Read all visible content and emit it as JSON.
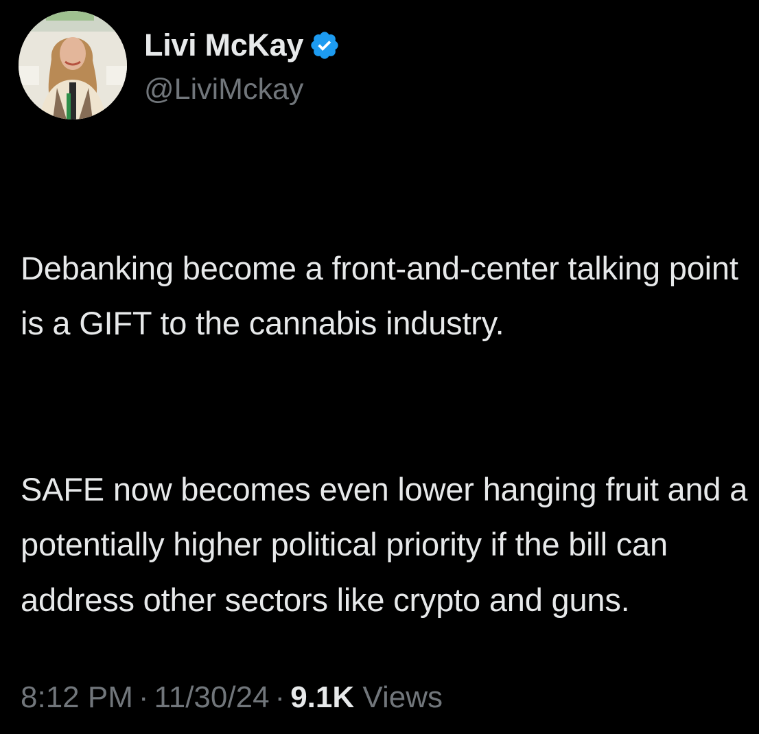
{
  "author": {
    "display_name": "Livi McKay",
    "handle": "@LiviMckay",
    "verified": true,
    "verified_color": "#1d9bf0",
    "avatar_icon": "profile-photo"
  },
  "tweet": {
    "paragraphs": [
      "Debanking become a front-and-center talking point is a GIFT to the cannabis industry.",
      "SAFE now becomes even lower hanging fruit and a potentially higher political priority if the bill can address other sectors like crypto and guns."
    ]
  },
  "meta": {
    "time": "8:12 PM",
    "separator": "·",
    "date": "11/30/24",
    "views_count": "9.1K",
    "views_label": "Views"
  },
  "colors": {
    "background": "#000000",
    "primary_text": "#e7e9ea",
    "secondary_text": "#71767b"
  }
}
